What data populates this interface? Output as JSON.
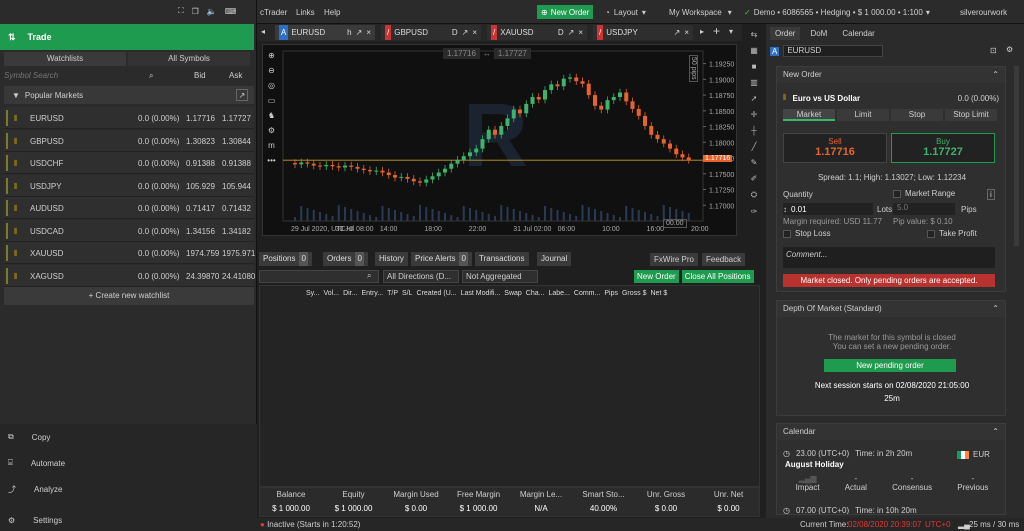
{
  "topbar": {
    "app": "cTrader",
    "links": "Links",
    "help": "Help",
    "new_order": "New Order",
    "layout": "Layout",
    "workspace": "My Workspace",
    "account": "Demo • 6086565 • Hedging • $ 1 000.00 • 1:100",
    "user": "silverourwork"
  },
  "left": {
    "trade": "Trade",
    "tab_watchlists": "Watchlists",
    "tab_all": "All Symbols",
    "search_placeholder": "Symbol Search",
    "bid": "Bid",
    "ask": "Ask",
    "popular": "Popular Markets",
    "create": "+ Create new watchlist",
    "symbols": [
      {
        "name": "EURUSD",
        "change": "0.0 (0.00%)",
        "bid": "1.17716",
        "ask": "1.17727"
      },
      {
        "name": "GBPUSD",
        "change": "0.0 (0.00%)",
        "bid": "1.30823",
        "ask": "1.30844"
      },
      {
        "name": "USDCHF",
        "change": "0.0 (0.00%)",
        "bid": "0.91388",
        "ask": "0.91388"
      },
      {
        "name": "USDJPY",
        "change": "0.0 (0.00%)",
        "bid": "105.929",
        "ask": "105.944"
      },
      {
        "name": "AUDUSD",
        "change": "0.0 (0.00%)",
        "bid": "0.71417",
        "ask": "0.71432"
      },
      {
        "name": "USDCAD",
        "change": "0.0 (0.00%)",
        "bid": "1.34156",
        "ask": "1.34182"
      },
      {
        "name": "XAUUSD",
        "change": "0.0 (0.00%)",
        "bid": "1974.759",
        "ask": "1975.971"
      },
      {
        "name": "XAGUSD",
        "change": "0.0 (0.00%)",
        "bid": "24.39870",
        "ask": "24.41080"
      }
    ],
    "menu": {
      "copy": "Copy",
      "automate": "Automate",
      "analyze": "Analyze",
      "settings": "Settings"
    }
  },
  "chart": {
    "tabs": [
      {
        "sym": "EURUSD",
        "tf": "h"
      },
      {
        "sym": "GBPUSD",
        "tf": "D"
      },
      {
        "sym": "XAUUSD",
        "tf": "D"
      },
      {
        "sym": "USDJPY",
        "tf": ""
      }
    ],
    "bid_box": "1.17716",
    "ask_box": "1.17727",
    "pips": "50 pips",
    "current_price": "1.17716",
    "pips_bottom": "00.00",
    "price_ticks": [
      "1.19250",
      "1.19000",
      "1.18750",
      "1.18500",
      "1.18250",
      "1.18000",
      "1.17750",
      "1.17500",
      "1.17250",
      "1.17000"
    ],
    "time_ticks": [
      "29 Jul 2020, UTC+0",
      "30 Jul 08:00",
      "14:00",
      "18:00",
      "22:00",
      "31 Jul 02:00",
      "06:00",
      "10:00",
      "16:00",
      "20:00"
    ]
  },
  "chart_data": {
    "type": "candlestick",
    "ylim": [
      1.1675,
      1.1945
    ],
    "closes": [
      1.1765,
      1.1768,
      1.1766,
      1.1763,
      1.1762,
      1.1764,
      1.1762,
      1.176,
      1.1763,
      1.1761,
      1.1758,
      1.1756,
      1.1754,
      1.1755,
      1.1752,
      1.1748,
      1.1744,
      1.1745,
      1.1742,
      1.1738,
      1.1736,
      1.1741,
      1.1746,
      1.1752,
      1.1758,
      1.1766,
      1.1772,
      1.1778,
      1.1784,
      1.179,
      1.1805,
      1.182,
      1.1812,
      1.1826,
      1.1838,
      1.1852,
      1.1846,
      1.1861,
      1.1872,
      1.1868,
      1.1883,
      1.1892,
      1.1889,
      1.1901,
      1.1903,
      1.1897,
      1.1893,
      1.1875,
      1.1858,
      1.1852,
      1.1867,
      1.1872,
      1.1879,
      1.1865,
      1.1853,
      1.1842,
      1.1826,
      1.1812,
      1.1805,
      1.1798,
      1.179,
      1.1781,
      1.1776,
      1.1772
    ]
  },
  "positions": {
    "tabs": [
      {
        "l": "Positions",
        "c": "0"
      },
      {
        "l": "Orders",
        "c": "0"
      },
      {
        "l": "History",
        "c": ""
      },
      {
        "l": "Price Alerts",
        "c": "0"
      },
      {
        "l": "Transactions",
        "c": ""
      },
      {
        "l": "Journal",
        "c": ""
      }
    ],
    "fxwire": "FxWire Pro",
    "feedback": "Feedback",
    "dir": "All Directions (D...",
    "agg": "Not Aggregated",
    "new_order": "New Order",
    "close_all": "Close All Positions",
    "cols": [
      "Sy...",
      "Vol...",
      "Dir...",
      "Entry...",
      "T/P",
      "S/L",
      "Created (U...",
      "Last Modifi...",
      "Swap",
      "Cha...",
      "Labe...",
      "Comm...",
      "Pips",
      "Gross $",
      "Net $"
    ],
    "summary_labels": [
      "Balance",
      "Equity",
      "Margin Used",
      "Free Margin",
      "Margin Le...",
      "Smart Sto...",
      "Unr. Gross",
      "Unr. Net"
    ],
    "summary_values": [
      "$ 1 000.00",
      "$ 1 000.00",
      "$ 0.00",
      "$ 1 000.00",
      "N/A",
      "40.00%",
      "$ 0.00",
      "$ 0.00"
    ]
  },
  "order": {
    "tabs": [
      "Order",
      "DoM",
      "Calendar"
    ],
    "symbol": "EURUSD",
    "new_order": "New Order",
    "title": "Euro vs US Dollar",
    "change": "0.0 (0.00%)",
    "types": [
      "Market",
      "Limit",
      "Stop",
      "Stop Limit"
    ],
    "sell": "Sell",
    "sell_price": "1.17716",
    "buy": "Buy",
    "buy_price": "1.17727",
    "spread": "Spread: 1.1; High: 1.13027; Low: 1.12234",
    "quantity": "Quantity",
    "qty_value": "0.01",
    "lots": "Lots",
    "market_range": "Market Range",
    "range_value": "5.0",
    "pips": "Pips",
    "margin_req": "Margin required: USD 11.77",
    "pip_value": "Pip value: $ 0.10",
    "stop_loss": "Stop Loss",
    "take_profit": "Take Profit",
    "comment": "Comment...",
    "closed_msg": "Market closed. Only pending orders are accepted."
  },
  "dom": {
    "title": "Depth Of Market (Standard)",
    "msg1": "The market for this symbol is closed",
    "msg2": "You can set a new pending order.",
    "button": "New pending order",
    "next": "Next session starts on 02/08/2020 21:05:00",
    "timer": "25m"
  },
  "calendar": {
    "title": "Calendar",
    "time": "23.00 (UTC+0)",
    "in": "Time: in 2h 20m",
    "event": "August Holiday",
    "currency": "EUR",
    "labels": [
      "Impact",
      "Actual",
      "Consensus",
      "Previous"
    ],
    "vals": [
      "-",
      "-",
      "-"
    ],
    "time2": "07.00 (UTC+0)",
    "in2": "Time: in 10h 20m"
  },
  "status": {
    "inactive": "Inactive (Starts in 1:20:52)",
    "current": "Current Time:",
    "datetime": "02/08/2020 20:39:07",
    "tz": "UTC+0",
    "latency": "25 ms / 30 ms"
  }
}
